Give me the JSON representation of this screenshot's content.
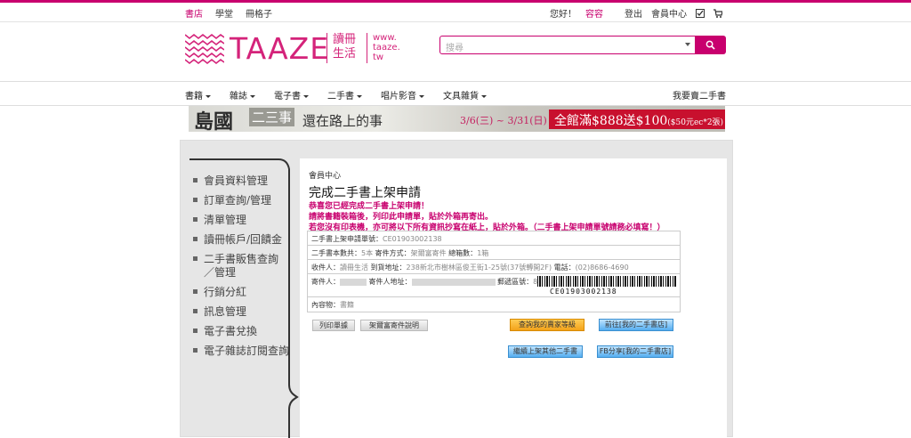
{
  "topbar": {
    "left_links": [
      "書店",
      "學堂",
      "冊格子"
    ],
    "greeting": "您好！",
    "user": "容容",
    "logout": "登出",
    "member_center": "會員中心"
  },
  "logo": {
    "word": "TAAZE",
    "chinese_line1": "讀冊",
    "chinese_line2": "生活",
    "url_line1": "www.",
    "url_line2": "taaze.",
    "url_line3": "tw"
  },
  "search": {
    "placeholder": "搜尋"
  },
  "nav": {
    "items": [
      "書籍",
      "雜誌",
      "電子書",
      "二手書",
      "唱片影音",
      "文具雜貨"
    ],
    "sell": "我要賣二手書"
  },
  "banner": {
    "t1": "島國",
    "t2": "二三事",
    "t3": "還在路上的事",
    "dates": "3/6(三) ~ 3/31(日)",
    "promo": "全館滿$888送$100",
    "promo_small": "($50元ec*2張)"
  },
  "sidebar": {
    "items": [
      "會員資料管理",
      "訂單查詢/管理",
      "清單管理",
      "讀冊帳戶/回饋金",
      "二手書販售查詢／管理",
      "行銷分紅",
      "訊息管理",
      "電子書兌換",
      "電子雜誌訂閱查詢"
    ]
  },
  "content": {
    "breadcrumb": "會員中心",
    "title": "完成二手書上架申請",
    "msg1": "恭喜您已經完成二手書上架申請！",
    "msg2": "請將書籍裝箱後，列印此申請單，貼於外箱再寄出。",
    "msg3": "若您沒有印表機，亦可將以下所有資訊抄寫在紙上，貼於外箱。（二手書上架申請單號請務必填寫！）",
    "row1_label": "二手書上架申請單號：",
    "row1_value": "CE01903002138",
    "row2_label1": "二手書本數共：",
    "row2_value1": "5本",
    "row2_label2": " 寄件方式：",
    "row2_value2": "架爾富寄件",
    "row2_label3": " 總箱數：",
    "row2_value3": "1箱",
    "row3_label1": "收件人：",
    "row3_value1": "讀冊生活",
    "row3_label2": " 到貨地址：",
    "row3_value2": "238新北市樹林區俊王街1-25號(37號轉開2F)",
    "row3_label3": " 電話：",
    "row3_value3": "(02)8686-4690",
    "row4_label1": "寄件人：",
    "row4_label2": "寄件人地址：",
    "row4_label3": "郵遞區號：",
    "row4_value3": "802",
    "barcode_number": "CE01903002138",
    "row5_label": "內容物：",
    "row5_value": "書籍",
    "btn_print": "列印單據",
    "btn_howto": "架爾富寄件說明",
    "btn_level": "查詢我的賣家等級",
    "btn_shop": "前往[我的二手書店]",
    "btn_continue": "繼續上架其他二手書",
    "btn_fb": "FB分享[我的二手書店]"
  },
  "colors": {
    "brand": "#c8006e",
    "sidebar_bg": "#e6e6e6"
  }
}
